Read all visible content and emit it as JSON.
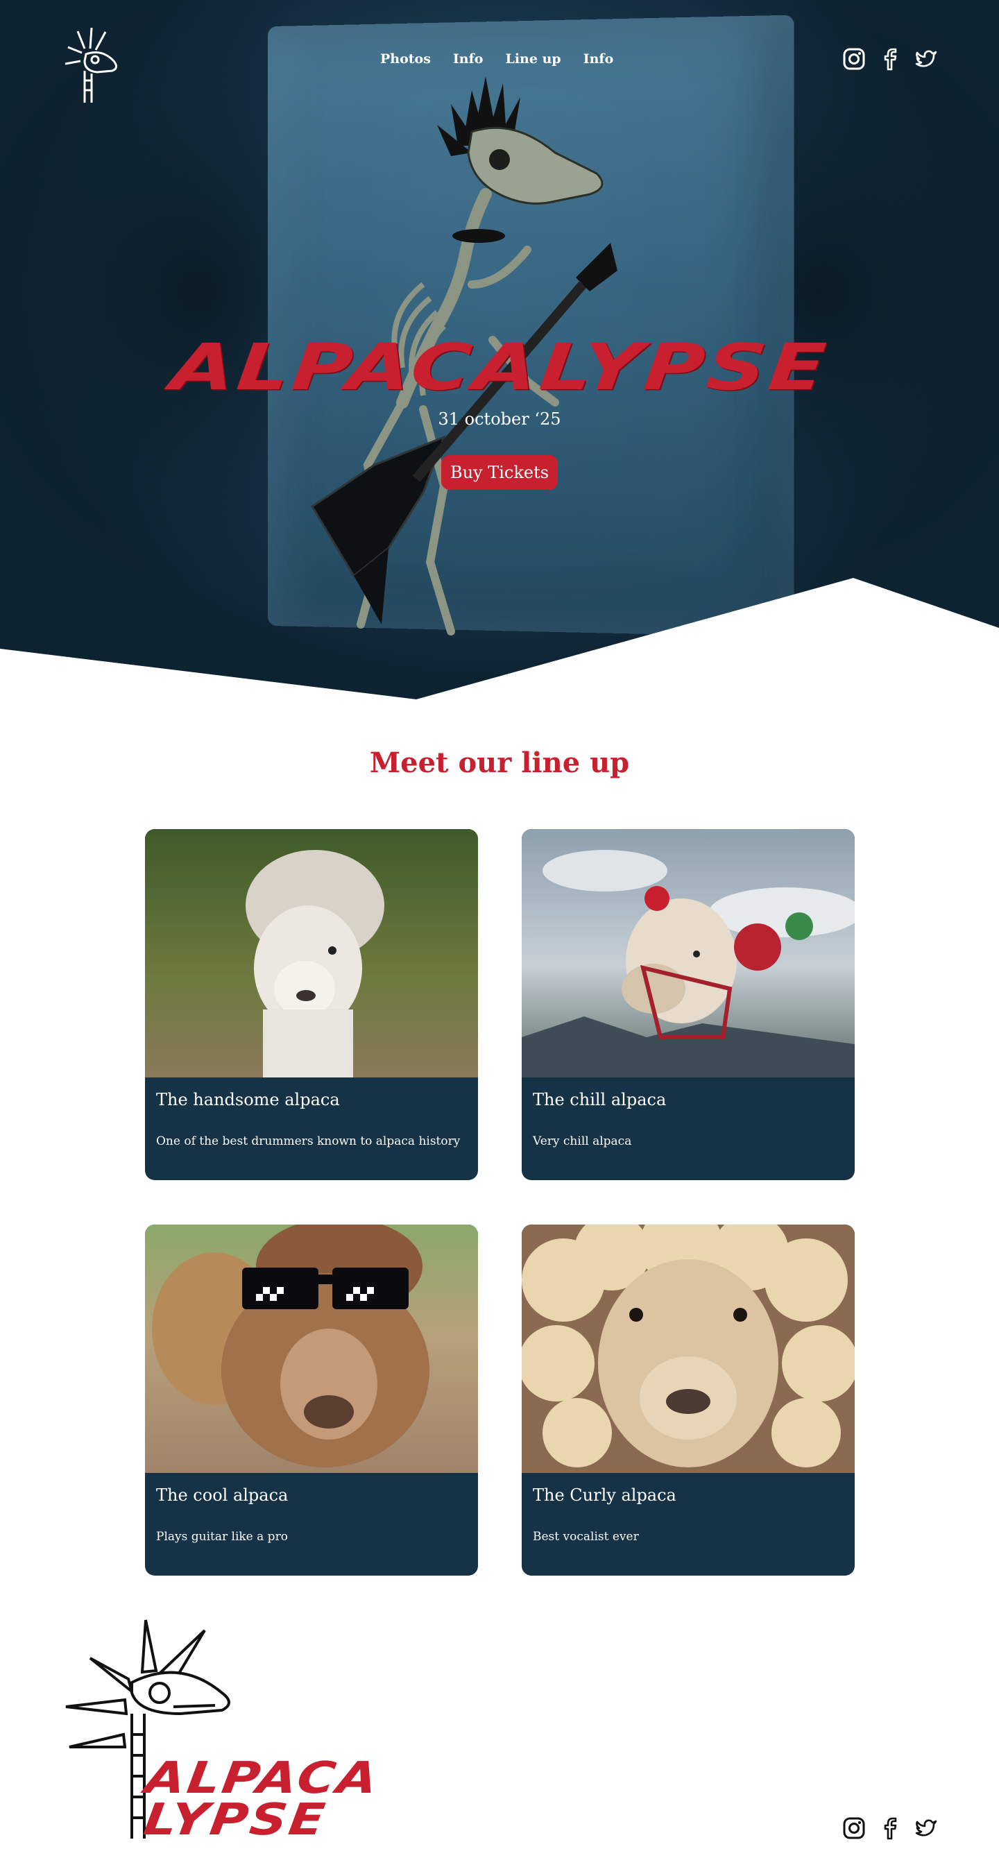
{
  "nav": {
    "links": [
      "Photos",
      "Info",
      "Line up",
      "Info"
    ]
  },
  "social": {
    "icons": [
      "instagram-icon",
      "facebook-icon",
      "twitter-icon"
    ]
  },
  "hero": {
    "title": "ALPACALYPSE",
    "date": "31 october ‘25",
    "cta": "Buy Tickets"
  },
  "lineup": {
    "heading": "Meet our line up",
    "cards": [
      {
        "title": "The handsome alpaca",
        "description": "One of the best drummers known to alpaca history"
      },
      {
        "title": "The chill alpaca",
        "description": "Very chill alpaca"
      },
      {
        "title": "The cool alpaca",
        "description": "Plays guitar like a pro"
      },
      {
        "title": "The Curly alpaca",
        "description": "Best vocalist ever"
      }
    ]
  },
  "footer": {
    "logo_line1": "ALPACA",
    "logo_line2": "LYPSE"
  },
  "colors": {
    "accent": "#c8202f",
    "card_bg": "#163247",
    "hero_bg": "#1b3a50"
  }
}
